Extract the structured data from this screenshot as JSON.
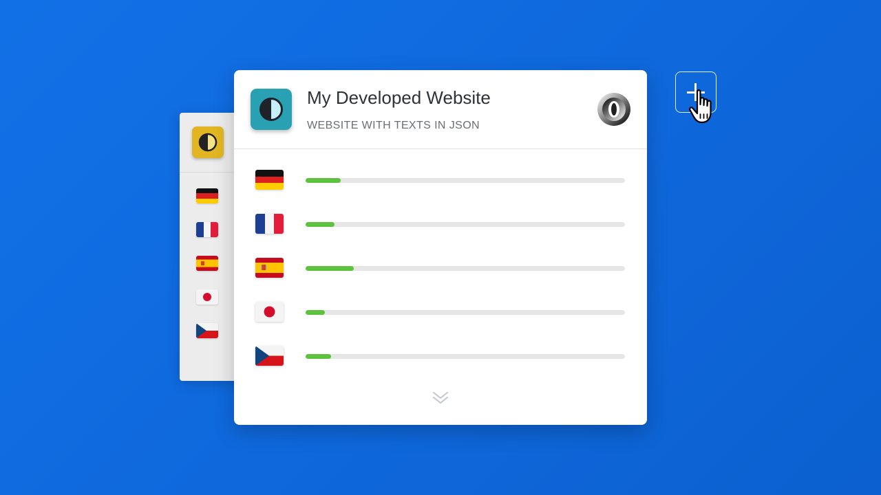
{
  "project": {
    "title": "My Developed Website",
    "subtitle": "WEBSITE WITH TEXTS IN JSON",
    "format_icon": "json-logo-icon",
    "app_icon": "contrast-icon"
  },
  "languages": [
    {
      "code": "de",
      "flag": "germany-flag-icon",
      "progress": 0.11
    },
    {
      "code": "fr",
      "flag": "france-flag-icon",
      "progress": 0.09
    },
    {
      "code": "es",
      "flag": "spain-flag-icon",
      "progress": 0.15
    },
    {
      "code": "ja",
      "flag": "japan-flag-icon",
      "progress": 0.06
    },
    {
      "code": "cs",
      "flag": "czech-flag-icon",
      "progress": 0.08
    }
  ],
  "back_project": {
    "app_icon": "contrast-icon",
    "flags": [
      "germany-flag-icon",
      "france-flag-icon",
      "spain-flag-icon",
      "japan-flag-icon",
      "czech-flag-icon"
    ]
  },
  "actions": {
    "add_icon": "plus-icon",
    "expand_icon": "chevron-double-down-icon",
    "cursor": "hand-pointer-icon"
  },
  "colors": {
    "background": "#1270e6",
    "progress_fill": "#5dc23e",
    "progress_track": "#e6e6e6",
    "main_app_icon": "#2aa0b3",
    "back_app_icon": "#e1b622"
  }
}
